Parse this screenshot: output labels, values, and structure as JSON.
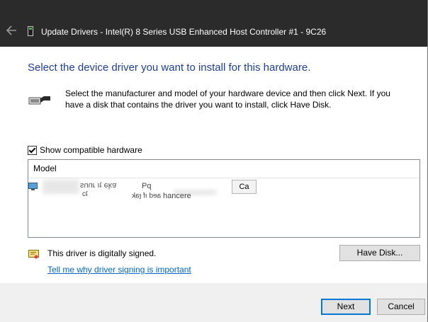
{
  "window": {
    "title": "Update Drivers - Intel(R) 8 Series USB Enhanced Host Controller #1 - 9C26"
  },
  "dialog": {
    "heading": "Select the device driver you want to install for this hardware.",
    "instructions": "Select the manufacturer and model of your hardware device and then click Next. If you have a disk that contains the driver you want to install, click Have Disk.",
    "show_compatible_label": "Show compatible hardware",
    "show_compatible_checked": true,
    "model_header": "Model",
    "model_row_fragments": [
      "Series",
      "ɐʞǝ ʇı ɹnns",
      "Pq",
      "tro",
      "ʇɔ",
      "hancere",
      "ʞɐʇ ɟı pǝɐ"
    ],
    "overlay_button_fragment": "Ca",
    "signed_text": "This driver is digitally signed.",
    "signing_link": "Tell me why driver signing is important",
    "have_disk_label": "Have Disk...",
    "next_label": "Next",
    "cancel_label": "Cancel"
  },
  "icons": {
    "back": "back-arrow-icon",
    "device": "device-icon",
    "usb": "usb-connector-icon",
    "monitor": "monitor-icon",
    "certificate": "certificate-icon"
  },
  "colors": {
    "title_bar": "#2b2b2b",
    "heading": "#1e3e9b",
    "link": "#0066cc",
    "primary_border": "#0078d7",
    "footer": "#f0f0f0"
  }
}
